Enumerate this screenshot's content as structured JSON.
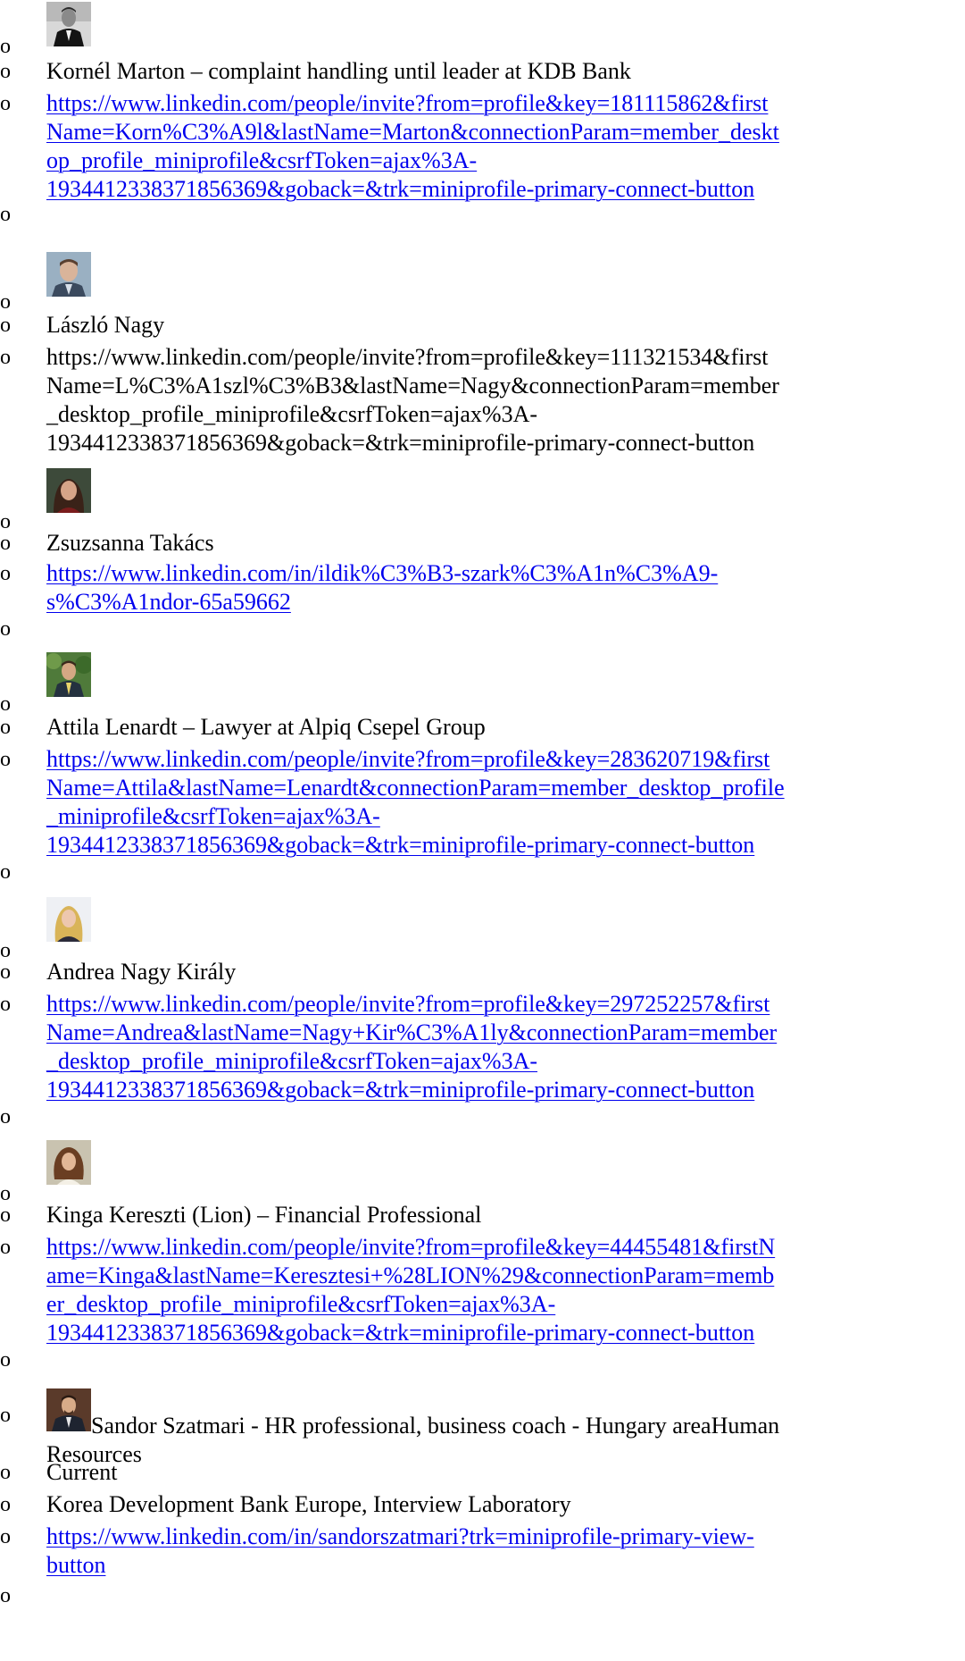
{
  "bullet_glyph": "o",
  "entries": [
    {
      "name": "Kornél Marton – complaint handling until leader at KDB Bank",
      "url": "https://www.linkedin.com/people/invite?from=profile&key=181115862&firstName=Korn%C3%A9l&lastName=Marton&connectionParam=member_desktop_profile_miniprofile&csrfToken=ajax%3A-1934412338371856369&goback=&trk=miniprofile-primary-connect-button",
      "url_lines": [
        "https://www.linkedin.com/people/invite?from=profile&key=181115862&first",
        "Name=Korn%C3%A9l&lastName=Marton&connectionParam=member_deskt",
        "op_profile_miniprofile&csrfToken=ajax%3A-",
        "1934412338371856369&goback=&trk=miniprofile-primary-connect-button"
      ],
      "url_is_link": true
    },
    {
      "name": "László Nagy",
      "url": "https://www.linkedin.com/people/invite?from=profile&key=111321534&firstName=L%C3%A1szl%C3%B3&lastName=Nagy&connectionParam=member_desktop_profile_miniprofile&csrfToken=ajax%3A-1934412338371856369&goback=&trk=miniprofile-primary-connect-button",
      "url_lines": [
        "https://www.linkedin.com/people/invite?from=profile&key=111321534&first",
        "Name=L%C3%A1szl%C3%B3&lastName=Nagy&connectionParam=member",
        "_desktop_profile_miniprofile&csrfToken=ajax%3A-",
        "1934412338371856369&goback=&trk=miniprofile-primary-connect-button"
      ],
      "url_is_link": false
    },
    {
      "name": "Zsuzsanna Takács",
      "url": "https://www.linkedin.com/in/ildik%C3%B3-szark%C3%A1n%C3%A9-s%C3%A1ndor-65a59662",
      "url_lines": [
        "https://www.linkedin.com/in/ildik%C3%B3-szark%C3%A1n%C3%A9-",
        "s%C3%A1ndor-65a59662"
      ],
      "url_is_link": true
    },
    {
      "name": "Attila Lenardt – Lawyer at Alpiq Csepel Group",
      "url": "https://www.linkedin.com/people/invite?from=profile&key=283620719&firstName=Attila&lastName=Lenardt&connectionParam=member_desktop_profile_miniprofile&csrfToken=ajax%3A-1934412338371856369&goback=&trk=miniprofile-primary-connect-button",
      "url_lines": [
        "https://www.linkedin.com/people/invite?from=profile&key=283620719&first",
        "Name=Attila&lastName=Lenardt&connectionParam=member_desktop_profile",
        "_miniprofile&csrfToken=ajax%3A-",
        "1934412338371856369&goback=&trk=miniprofile-primary-connect-button"
      ],
      "url_is_link": true
    },
    {
      "name": "Andrea Nagy Király",
      "url": "https://www.linkedin.com/people/invite?from=profile&key=297252257&firstName=Andrea&lastName=Nagy+Kir%C3%A1ly&connectionParam=member_desktop_profile_miniprofile&csrfToken=ajax%3A-1934412338371856369&goback=&trk=miniprofile-primary-connect-button",
      "url_lines": [
        "https://www.linkedin.com/people/invite?from=profile&key=297252257&first",
        "Name=Andrea&lastName=Nagy+Kir%C3%A1ly&connectionParam=member",
        "_desktop_profile_miniprofile&csrfToken=ajax%3A-",
        "1934412338371856369&goback=&trk=miniprofile-primary-connect-button"
      ],
      "url_is_link": true
    },
    {
      "name": "Kinga Kereszti (Lion) – Financial Professional",
      "url": "https://www.linkedin.com/people/invite?from=profile&key=44455481&firstName=Kinga&lastName=Keresztesi+%28LION%29&connectionParam=member_desktop_profile_miniprofile&csrfToken=ajax%3A-1934412338371856369&goback=&trk=miniprofile-primary-connect-button",
      "url_lines": [
        "https://www.linkedin.com/people/invite?from=profile&key=44455481&firstN",
        "ame=Kinga&lastName=Keresztesi+%28LION%29&connectionParam=memb",
        "er_desktop_profile_miniprofile&csrfToken=ajax%3A-",
        "1934412338371856369&goback=&trk=miniprofile-primary-connect-button"
      ],
      "url_is_link": true
    }
  ],
  "last_entry": {
    "name_lines": [
      "Sandor Szatmari - HR professional, business coach - Hungary areaHuman",
      "Resources"
    ],
    "current_label": "Current",
    "companies": "Korea Development Bank Europe, Interview Laboratory",
    "url": "https://www.linkedin.com/in/sandorszatmari?trk=miniprofile-primary-view-button",
    "url_lines": [
      "https://www.linkedin.com/in/sandorszatmari?trk=miniprofile-primary-view-",
      "button"
    ]
  }
}
